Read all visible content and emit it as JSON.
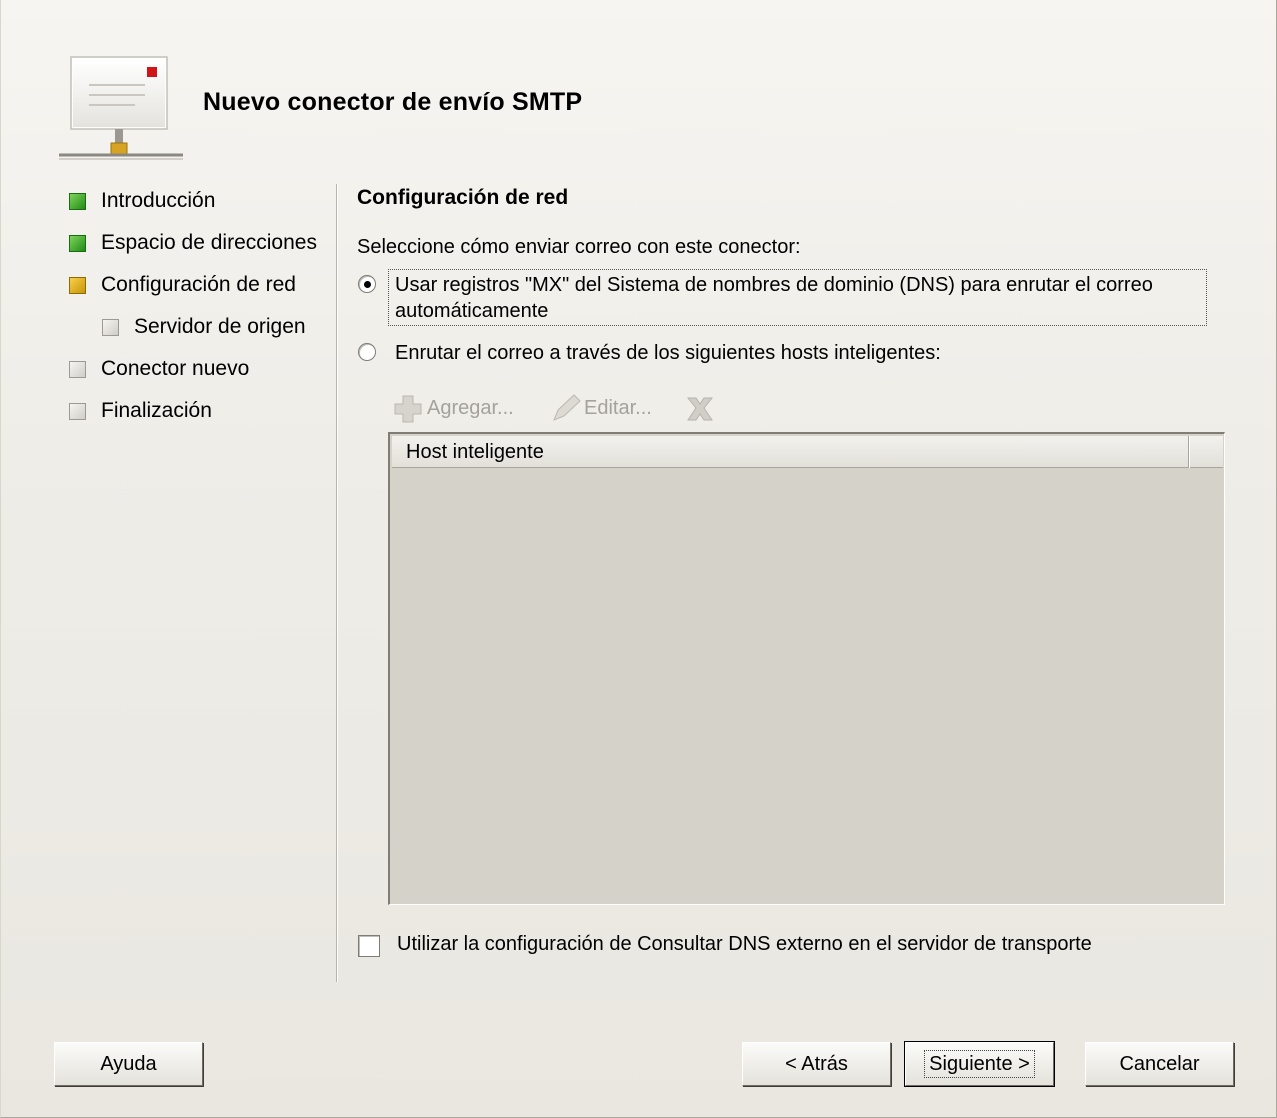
{
  "window": {
    "title": "Nuevo conector de envío SMTP"
  },
  "wizard_steps": [
    {
      "label": "Introducción",
      "state": "done"
    },
    {
      "label": "Espacio de direcciones",
      "state": "done"
    },
    {
      "label": "Configuración de red",
      "state": "current"
    },
    {
      "label": "Servidor de origen",
      "state": "pending"
    },
    {
      "label": "Conector nuevo",
      "state": "pending"
    },
    {
      "label": "Finalización",
      "state": "pending"
    }
  ],
  "page": {
    "section_title": "Configuración de red",
    "prompt": "Seleccione cómo enviar correo con este conector:",
    "option_dns_line1": "Usar registros \"MX\" del Sistema de nombres de dominio (DNS) para enrutar el correo",
    "option_dns_line2": "automáticamente",
    "option_dns_selected": true,
    "option_smarthost": "Enrutar el correo a través de los siguientes hosts inteligentes:",
    "option_smarthost_selected": false
  },
  "toolbar": {
    "add_label": "Agregar...",
    "edit_label": "Editar...",
    "remove_icon": "x-icon"
  },
  "smart_host_list": {
    "columns": [
      "Host inteligente"
    ],
    "rows": []
  },
  "external_dns_checkbox": {
    "label": "Utilizar la configuración de Consultar DNS externo en el servidor de transporte",
    "checked": false
  },
  "buttons": {
    "help": "Ayuda",
    "back": "< Atrás",
    "next": "Siguiente >",
    "cancel": "Cancelar"
  },
  "colors": {
    "step_done": "#2e9a20",
    "step_current": "#e2b21c",
    "step_pending": "#c8c6bf"
  }
}
